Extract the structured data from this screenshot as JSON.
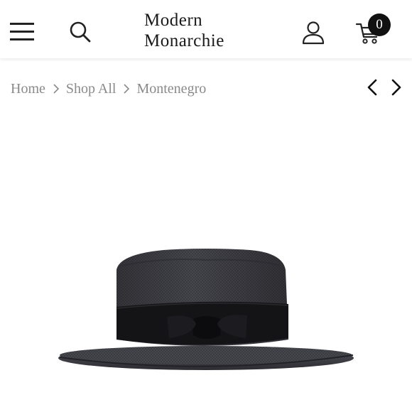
{
  "header": {
    "logo_line1": "Modern",
    "logo_line2": "Monarchie",
    "cart_count": "0"
  },
  "breadcrumb": {
    "items": [
      "Home",
      "Shop All",
      "Montenegro"
    ]
  },
  "icons": {
    "menu": "menu-icon",
    "search": "search-icon",
    "account": "user-icon",
    "cart": "cart-icon",
    "prev": "chevron-left-icon",
    "next": "chevron-right-icon"
  },
  "colors": {
    "accent": "#111111",
    "breadcrumb_text": "#8a8a8a",
    "hat_body": "#3a3a40",
    "hat_band": "#141416"
  }
}
